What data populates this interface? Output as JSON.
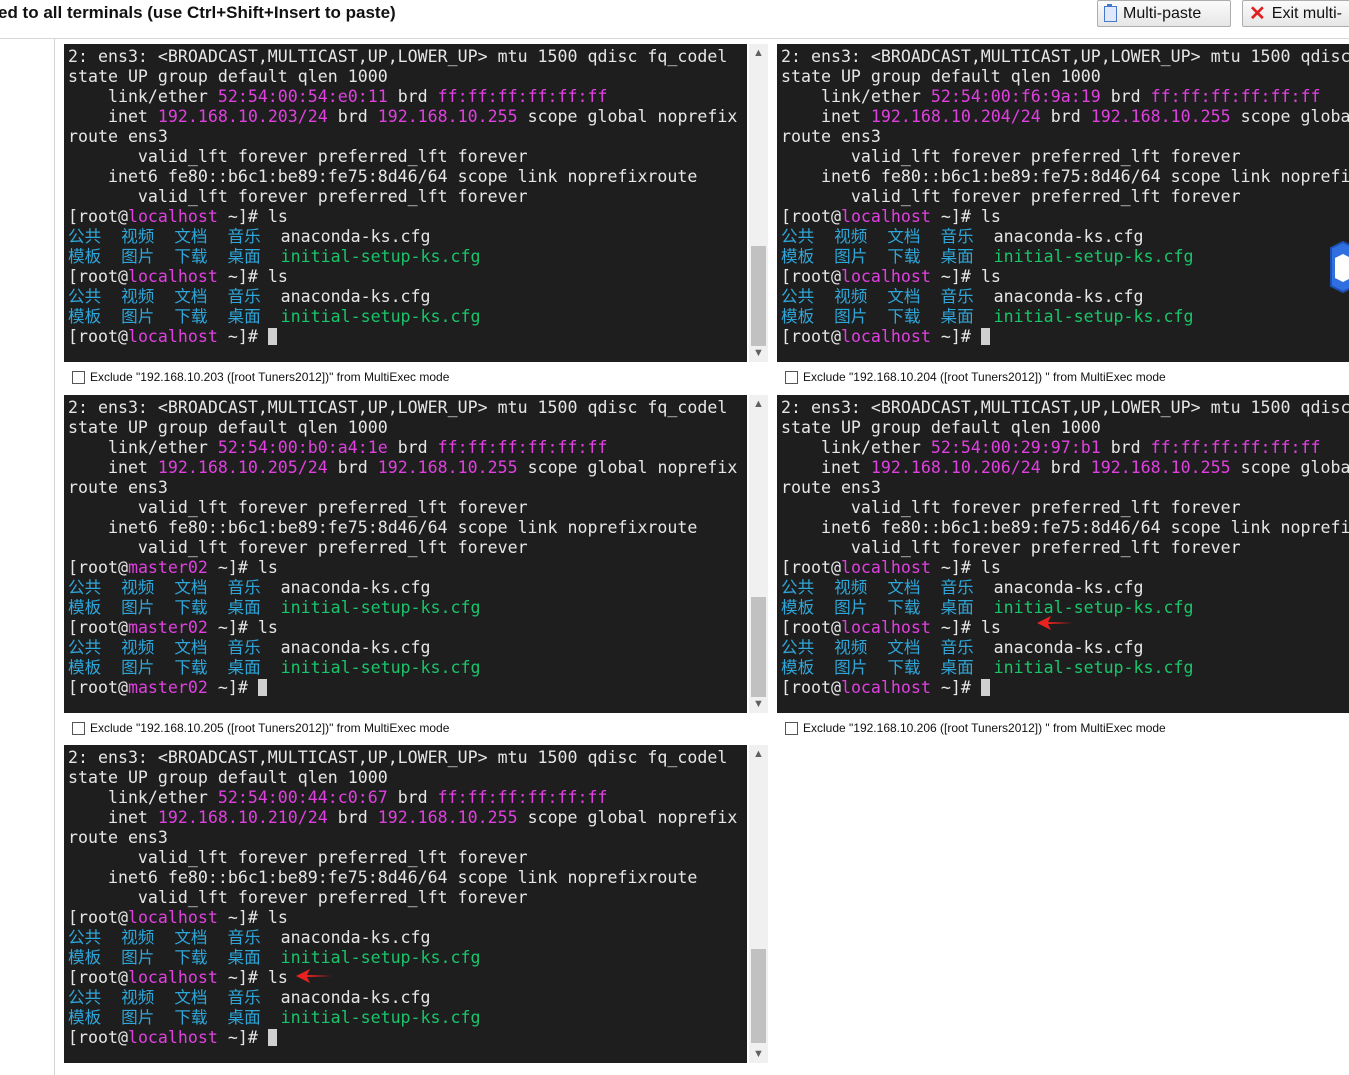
{
  "toolbar": {
    "message": "ed to all terminals (use Ctrl+Shift+Insert to paste)",
    "multipaste_label": "Multi-paste",
    "exit_label": "Exit multi-"
  },
  "terminals": [
    {
      "inet": "192.168.10.203/24",
      "mac": "52:54:00:54:e0:11",
      "host": "localhost",
      "exclude": "Exclude \"192.168.10.203 ([root  Tuners2012])\" from MultiExec mode"
    },
    {
      "inet": "192.168.10.204/24",
      "mac": "52:54:00:f6:9a:19",
      "host": "localhost",
      "exclude": "Exclude \"192.168.10.204 ([root  Tuners2012]) \" from MultiExec mode"
    },
    {
      "inet": "192.168.10.205/24",
      "mac": "52:54:00:b0:a4:1e",
      "host": "master02",
      "exclude": "Exclude \"192.168.10.205 ([root  Tuners2012])\" from MultiExec mode"
    },
    {
      "inet": "192.168.10.206/24",
      "mac": "52:54:00:29:97:b1",
      "host": "localhost",
      "exclude": "Exclude \"192.168.10.206 ([root  Tuners2012]) \" from MultiExec mode"
    },
    {
      "inet": "192.168.10.210/24",
      "mac": "52:54:00:44:c0:67",
      "host": "localhost",
      "exclude": ""
    }
  ],
  "common": {
    "line1": "2: ens3: <BROADCAST,MULTICAST,UP,LOWER_UP> mtu 1500 qdisc fq_codel",
    "line2": "state UP group default qlen 1000",
    "link_prefix": "    link/ether ",
    "brd_word": " brd ",
    "brd_mac": "ff:ff:ff:ff:ff:ff",
    "inet_prefix": "    inet ",
    "brd_ip": "192.168.10.255",
    "inet_suffix": " scope global noprefix",
    "route": "route ens3",
    "valid1": "       valid_lft forever preferred_lft forever",
    "inet6": "    inet6 fe80::b6c1:be89:fe75:8d46/64 scope link noprefixroute",
    "valid2": "       valid_lft forever preferred_lft forever",
    "prompt_open": "[root@",
    "prompt_close": " ~]# ",
    "cmd": "ls",
    "dirs1": "公共  视频  文档  音乐  ",
    "file1": "anaconda-ks.cfg",
    "dirs2": "模板  图片  下载  桌面  ",
    "file2": "initial-setup-ks.cfg"
  },
  "colors": {
    "terminal_bg": "#1e1e1e",
    "magenta": "#e040e0",
    "cyan": "#2fa6d9",
    "green": "#19c46a",
    "arrow_red": "#e8231f"
  },
  "icons": [
    "paste-icon",
    "close-x-icon",
    "shield-badge-icon",
    "red-arrow-icon"
  ]
}
